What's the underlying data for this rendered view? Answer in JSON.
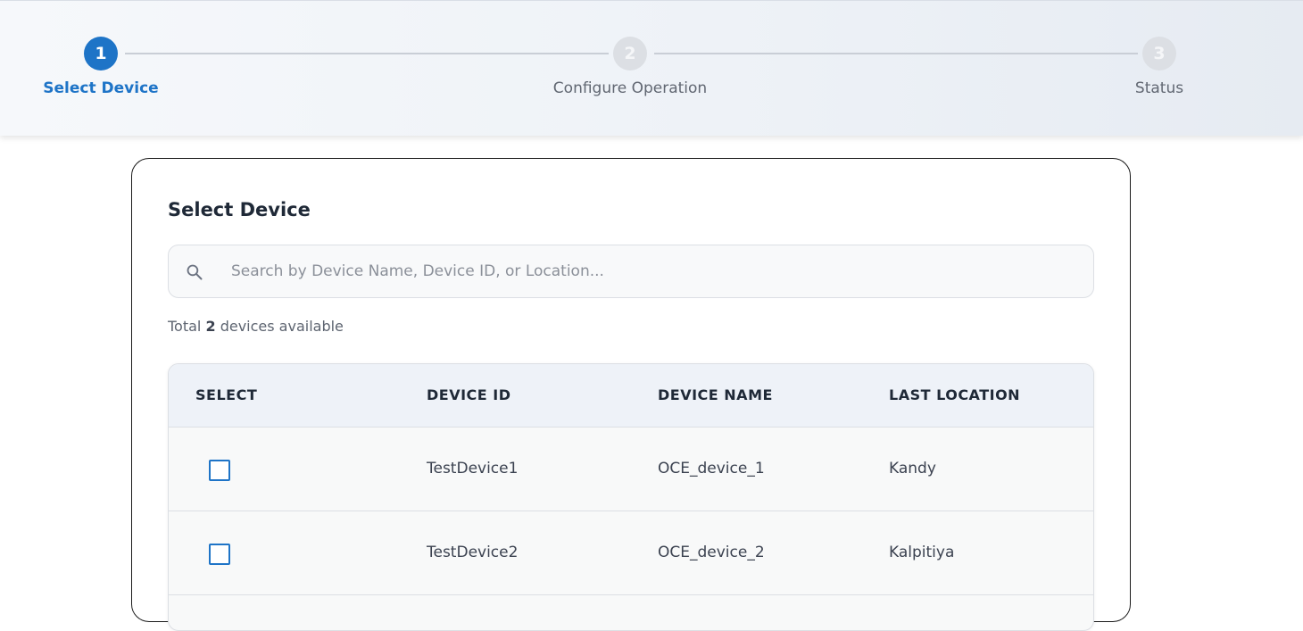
{
  "stepper": {
    "steps": [
      {
        "number": "1",
        "label": "Select Device",
        "state": "active"
      },
      {
        "number": "2",
        "label": "Configure Operation",
        "state": "inactive"
      },
      {
        "number": "3",
        "label": "Status",
        "state": "inactive"
      }
    ],
    "active_color": "#1e74c7"
  },
  "card": {
    "title": "Select Device",
    "search": {
      "icon": "search-icon",
      "placeholder": "Search by Device Name, Device ID, or Location...",
      "value": ""
    },
    "total": {
      "prefix": "Total",
      "count": "2",
      "suffix": "devices available"
    },
    "table": {
      "columns": [
        "SELECT",
        "DEVICE ID",
        "DEVICE NAME",
        "LAST LOCATION"
      ],
      "rows": [
        {
          "selected": false,
          "device_id": "TestDevice1",
          "device_name": "OCE_device_1",
          "last_location": "Kandy"
        },
        {
          "selected": false,
          "device_id": "TestDevice2",
          "device_name": "OCE_device_2",
          "last_location": "Kalpitiya"
        }
      ]
    }
  }
}
